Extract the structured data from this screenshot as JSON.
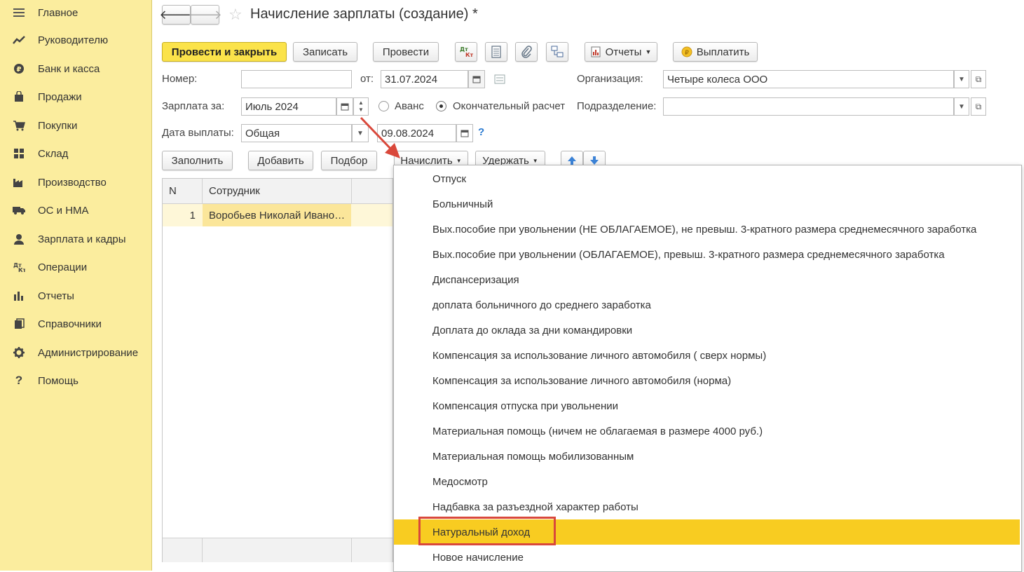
{
  "sidebar": {
    "items": [
      {
        "label": "Главное",
        "icon": "menu-icon"
      },
      {
        "label": "Руководителю",
        "icon": "trend-icon"
      },
      {
        "label": "Банк и касса",
        "icon": "coin-icon"
      },
      {
        "label": "Продажи",
        "icon": "bag-icon"
      },
      {
        "label": "Покупки",
        "icon": "cart-icon"
      },
      {
        "label": "Склад",
        "icon": "warehouse-icon"
      },
      {
        "label": "Производство",
        "icon": "factory-icon"
      },
      {
        "label": "ОС и НМА",
        "icon": "truck-icon"
      },
      {
        "label": "Зарплата и кадры",
        "icon": "person-icon"
      },
      {
        "label": "Операции",
        "icon": "dt-kt-icon"
      },
      {
        "label": "Отчеты",
        "icon": "bar-chart-icon"
      },
      {
        "label": "Справочники",
        "icon": "books-icon"
      },
      {
        "label": "Администрирование",
        "icon": "gear-icon"
      },
      {
        "label": "Помощь",
        "icon": "question-icon"
      }
    ]
  },
  "header": {
    "title": "Начисление зарплаты (создание) *"
  },
  "toolbar": {
    "post_close": "Провести и закрыть",
    "save": "Записать",
    "post": "Провести",
    "reports": "Отчеты",
    "pay": "Выплатить"
  },
  "form": {
    "number_label": "Номер:",
    "number_value": "",
    "from_label": "от:",
    "date_value": "31.07.2024",
    "org_label": "Организация:",
    "org_value": "Четыре колеса ООО",
    "salary_for_label": "Зарплата за:",
    "salary_for_value": "Июль 2024",
    "advance_label": "Аванс",
    "final_label": "Окончательный расчет",
    "subdivision_label": "Подразделение:",
    "subdivision_value": "",
    "pay_date_label": "Дата выплаты:",
    "pay_type_value": "Общая",
    "pay_date_value": "09.08.2024",
    "help": "?"
  },
  "table_toolbar": {
    "fill": "Заполнить",
    "add": "Добавить",
    "select": "Подбор",
    "accrue": "Начислить",
    "withhold": "Удержать"
  },
  "table": {
    "columns": [
      "N",
      "Сотрудник"
    ],
    "rows": [
      {
        "n": "1",
        "employee": "Воробьев Николай Ивано…"
      }
    ]
  },
  "menu": {
    "items": [
      "Отпуск",
      "Больничный",
      "Вых.пособие при увольнении (НЕ ОБЛАГАЕМОЕ), не превыш. 3-кратного размера среднемесячного заработка",
      "Вых.пособие при увольнении (ОБЛАГАЕМОЕ), превыш. 3-кратного размера среднемесячного заработка",
      "Диспансеризация",
      "доплата больничного до среднего заработка",
      "Доплата до оклада за дни командировки",
      "Компенсация за использование личного автомобиля ( сверх нормы)",
      "Компенсация за использование личного автомобиля (норма)",
      "Компенсация отпуска при увольнении",
      "Материальная помощь (ничем не облагаемая в размере 4000 руб.)",
      "Материальная помощь мобилизованным",
      "Медосмотр",
      "Надбавка за разъездной характер работы",
      "Натуральный доход",
      "Новое начисление"
    ],
    "highlighted_index": 14
  },
  "colors": {
    "sidebar_bg": "#fbed9e",
    "primary_button": "#fbe34a",
    "highlight": "#f8cc21",
    "annotation_red": "#d9483b"
  }
}
